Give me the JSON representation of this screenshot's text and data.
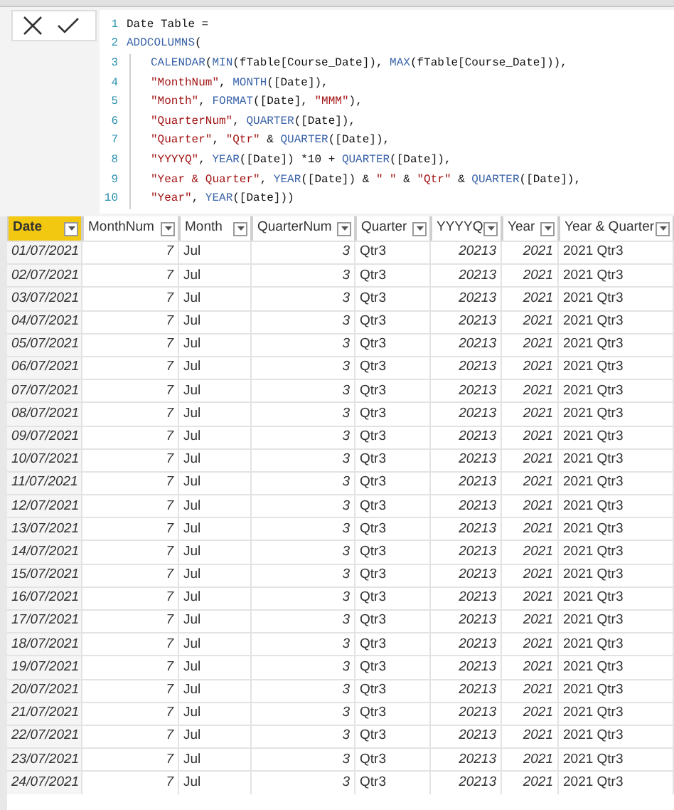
{
  "formula_bar": {
    "buttons": [
      {
        "kind": "cancel"
      },
      {
        "kind": "commit"
      }
    ],
    "lines": [
      {
        "number": "1",
        "indented": false,
        "segments": [
          {
            "kind": "plain",
            "text": "Date Table ="
          }
        ]
      },
      {
        "number": "2",
        "indented": false,
        "segments": [
          {
            "kind": "fn",
            "text": "ADDCOLUMNS"
          },
          {
            "kind": "plain",
            "text": "("
          }
        ]
      },
      {
        "number": "3",
        "indented": true,
        "segments": [
          {
            "kind": "fn",
            "text": "CALENDAR"
          },
          {
            "kind": "plain",
            "text": "("
          },
          {
            "kind": "fn",
            "text": "MIN"
          },
          {
            "kind": "plain",
            "text": "(fTable[Course_Date]), "
          },
          {
            "kind": "fn",
            "text": "MAX"
          },
          {
            "kind": "plain",
            "text": "(fTable[Course_Date])),"
          }
        ]
      },
      {
        "number": "4",
        "indented": true,
        "segments": [
          {
            "kind": "str",
            "text": "\"MonthNum\""
          },
          {
            "kind": "plain",
            "text": ", "
          },
          {
            "kind": "fn",
            "text": "MONTH"
          },
          {
            "kind": "plain",
            "text": "([Date]),"
          }
        ]
      },
      {
        "number": "5",
        "indented": true,
        "segments": [
          {
            "kind": "str",
            "text": "\"Month\""
          },
          {
            "kind": "plain",
            "text": ", "
          },
          {
            "kind": "fn",
            "text": "FORMAT"
          },
          {
            "kind": "plain",
            "text": "([Date], "
          },
          {
            "kind": "str",
            "text": "\"MMM\""
          },
          {
            "kind": "plain",
            "text": "),"
          }
        ]
      },
      {
        "number": "6",
        "indented": true,
        "segments": [
          {
            "kind": "str",
            "text": "\"QuarterNum\""
          },
          {
            "kind": "plain",
            "text": ", "
          },
          {
            "kind": "fn",
            "text": "QUARTER"
          },
          {
            "kind": "plain",
            "text": "([Date]),"
          }
        ]
      },
      {
        "number": "7",
        "indented": true,
        "segments": [
          {
            "kind": "str",
            "text": "\"Quarter\""
          },
          {
            "kind": "plain",
            "text": ", "
          },
          {
            "kind": "str",
            "text": "\"Qtr\""
          },
          {
            "kind": "plain",
            "text": " & "
          },
          {
            "kind": "fn",
            "text": "QUARTER"
          },
          {
            "kind": "plain",
            "text": "([Date]),"
          }
        ]
      },
      {
        "number": "8",
        "indented": true,
        "segments": [
          {
            "kind": "str",
            "text": "\"YYYYQ\""
          },
          {
            "kind": "plain",
            "text": ", "
          },
          {
            "kind": "fn",
            "text": "YEAR"
          },
          {
            "kind": "plain",
            "text": "([Date]) *10 + "
          },
          {
            "kind": "fn",
            "text": "QUARTER"
          },
          {
            "kind": "plain",
            "text": "([Date]),"
          }
        ]
      },
      {
        "number": "9",
        "indented": true,
        "segments": [
          {
            "kind": "str",
            "text": "\"Year & Quarter\""
          },
          {
            "kind": "plain",
            "text": ", "
          },
          {
            "kind": "fn",
            "text": "YEAR"
          },
          {
            "kind": "plain",
            "text": "([Date]) & "
          },
          {
            "kind": "str",
            "text": "\" \""
          },
          {
            "kind": "plain",
            "text": " & "
          },
          {
            "kind": "str",
            "text": "\"Qtr\""
          },
          {
            "kind": "plain",
            "text": " & "
          },
          {
            "kind": "fn",
            "text": "QUARTER"
          },
          {
            "kind": "plain",
            "text": "([Date]),"
          }
        ]
      },
      {
        "number": "10",
        "indented": true,
        "segments": [
          {
            "kind": "str",
            "text": "\"Year\""
          },
          {
            "kind": "plain",
            "text": ", "
          },
          {
            "kind": "fn",
            "text": "YEAR"
          },
          {
            "kind": "plain",
            "text": "([Date]))"
          }
        ]
      }
    ]
  },
  "table": {
    "columns": [
      {
        "label": "Date",
        "selected": true,
        "kind": "date"
      },
      {
        "label": "MonthNum",
        "selected": false,
        "kind": "number"
      },
      {
        "label": "Month",
        "selected": false,
        "kind": "text"
      },
      {
        "label": "QuarterNum",
        "selected": false,
        "kind": "number"
      },
      {
        "label": "Quarter",
        "selected": false,
        "kind": "text"
      },
      {
        "label": "YYYYQ",
        "selected": false,
        "kind": "number"
      },
      {
        "label": "Year",
        "selected": false,
        "kind": "number"
      },
      {
        "label": "Year & Quarter",
        "selected": false,
        "kind": "text"
      }
    ],
    "rows": [
      [
        "01/07/2021",
        "7",
        "Jul",
        "3",
        "Qtr3",
        "20213",
        "2021",
        "2021 Qtr3"
      ],
      [
        "02/07/2021",
        "7",
        "Jul",
        "3",
        "Qtr3",
        "20213",
        "2021",
        "2021 Qtr3"
      ],
      [
        "03/07/2021",
        "7",
        "Jul",
        "3",
        "Qtr3",
        "20213",
        "2021",
        "2021 Qtr3"
      ],
      [
        "04/07/2021",
        "7",
        "Jul",
        "3",
        "Qtr3",
        "20213",
        "2021",
        "2021 Qtr3"
      ],
      [
        "05/07/2021",
        "7",
        "Jul",
        "3",
        "Qtr3",
        "20213",
        "2021",
        "2021 Qtr3"
      ],
      [
        "06/07/2021",
        "7",
        "Jul",
        "3",
        "Qtr3",
        "20213",
        "2021",
        "2021 Qtr3"
      ],
      [
        "07/07/2021",
        "7",
        "Jul",
        "3",
        "Qtr3",
        "20213",
        "2021",
        "2021 Qtr3"
      ],
      [
        "08/07/2021",
        "7",
        "Jul",
        "3",
        "Qtr3",
        "20213",
        "2021",
        "2021 Qtr3"
      ],
      [
        "09/07/2021",
        "7",
        "Jul",
        "3",
        "Qtr3",
        "20213",
        "2021",
        "2021 Qtr3"
      ],
      [
        "10/07/2021",
        "7",
        "Jul",
        "3",
        "Qtr3",
        "20213",
        "2021",
        "2021 Qtr3"
      ],
      [
        "11/07/2021",
        "7",
        "Jul",
        "3",
        "Qtr3",
        "20213",
        "2021",
        "2021 Qtr3"
      ],
      [
        "12/07/2021",
        "7",
        "Jul",
        "3",
        "Qtr3",
        "20213",
        "2021",
        "2021 Qtr3"
      ],
      [
        "13/07/2021",
        "7",
        "Jul",
        "3",
        "Qtr3",
        "20213",
        "2021",
        "2021 Qtr3"
      ],
      [
        "14/07/2021",
        "7",
        "Jul",
        "3",
        "Qtr3",
        "20213",
        "2021",
        "2021 Qtr3"
      ],
      [
        "15/07/2021",
        "7",
        "Jul",
        "3",
        "Qtr3",
        "20213",
        "2021",
        "2021 Qtr3"
      ],
      [
        "16/07/2021",
        "7",
        "Jul",
        "3",
        "Qtr3",
        "20213",
        "2021",
        "2021 Qtr3"
      ],
      [
        "17/07/2021",
        "7",
        "Jul",
        "3",
        "Qtr3",
        "20213",
        "2021",
        "2021 Qtr3"
      ],
      [
        "18/07/2021",
        "7",
        "Jul",
        "3",
        "Qtr3",
        "20213",
        "2021",
        "2021 Qtr3"
      ],
      [
        "19/07/2021",
        "7",
        "Jul",
        "3",
        "Qtr3",
        "20213",
        "2021",
        "2021 Qtr3"
      ],
      [
        "20/07/2021",
        "7",
        "Jul",
        "3",
        "Qtr3",
        "20213",
        "2021",
        "2021 Qtr3"
      ],
      [
        "21/07/2021",
        "7",
        "Jul",
        "3",
        "Qtr3",
        "20213",
        "2021",
        "2021 Qtr3"
      ],
      [
        "22/07/2021",
        "7",
        "Jul",
        "3",
        "Qtr3",
        "20213",
        "2021",
        "2021 Qtr3"
      ],
      [
        "23/07/2021",
        "7",
        "Jul",
        "3",
        "Qtr3",
        "20213",
        "2021",
        "2021 Qtr3"
      ],
      [
        "24/07/2021",
        "7",
        "Jul",
        "3",
        "Qtr3",
        "20213",
        "2021",
        "2021 Qtr3"
      ]
    ]
  }
}
